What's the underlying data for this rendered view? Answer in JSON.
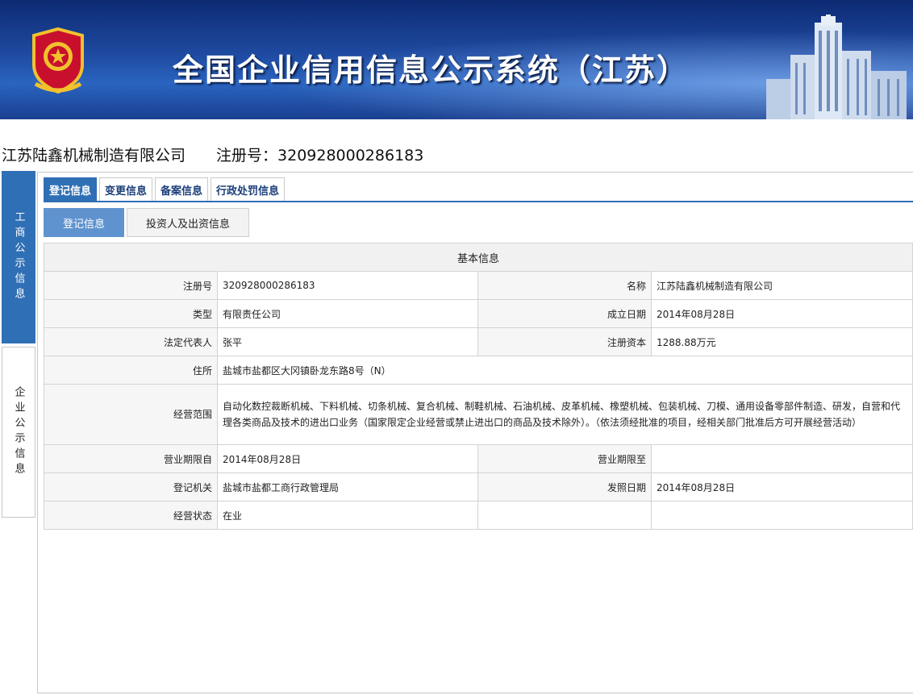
{
  "banner": {
    "title": "全国企业信用信息公示系统（江苏）"
  },
  "company": {
    "name": "江苏陆鑫机械制造有限公司",
    "reg_line": "注册号：320928000286183"
  },
  "side_tabs": [
    {
      "label": "工商公示信息",
      "active": true
    },
    {
      "label": "企业公示信息",
      "active": false
    }
  ],
  "tabs": [
    {
      "label": "登记信息",
      "active": true
    },
    {
      "label": "变更信息",
      "active": false
    },
    {
      "label": "备案信息",
      "active": false
    },
    {
      "label": "行政处罚信息",
      "active": false
    }
  ],
  "subtabs": [
    {
      "label": "登记信息",
      "active": true
    },
    {
      "label": "投资人及出资信息",
      "active": false
    }
  ],
  "info": {
    "caption": "基本信息",
    "reg_no_label": "注册号",
    "reg_no": "320928000286183",
    "name_label": "名称",
    "name": "江苏陆鑫机械制造有限公司",
    "type_label": "类型",
    "type": "有限责任公司",
    "founded_label": "成立日期",
    "founded": "2014年08月28日",
    "legal_rep_label": "法定代表人",
    "legal_rep": "张平",
    "capital_label": "注册资本",
    "capital": "1288.88万元",
    "address_label": "住所",
    "address": "盐城市盐都区大冈镇卧龙东路8号（N）",
    "scope_label": "经营范围",
    "scope": "自动化数控裁断机械、下料机械、切条机械、复合机械、制鞋机械、石油机械、皮革机械、橡塑机械、包装机械、刀模、通用设备零部件制造、研发，自营和代理各类商品及技术的进出口业务（国家限定企业经营或禁止进出口的商品及技术除外）。（依法须经批准的项目，经相关部门批准后方可开展经营活动）",
    "term_from_label": "营业期限自",
    "term_from": "2014年08月28日",
    "term_to_label": "营业期限至",
    "term_to": "",
    "authority_label": "登记机关",
    "authority": "盐城市盐都工商行政管理局",
    "issue_date_label": "发照日期",
    "issue_date": "2014年08月28日",
    "status_label": "经营状态",
    "status": "在业"
  },
  "colors": {
    "accent": "#2f6fb5",
    "subtab_active": "#5f93cf",
    "banner_dark": "#0d2a73"
  }
}
